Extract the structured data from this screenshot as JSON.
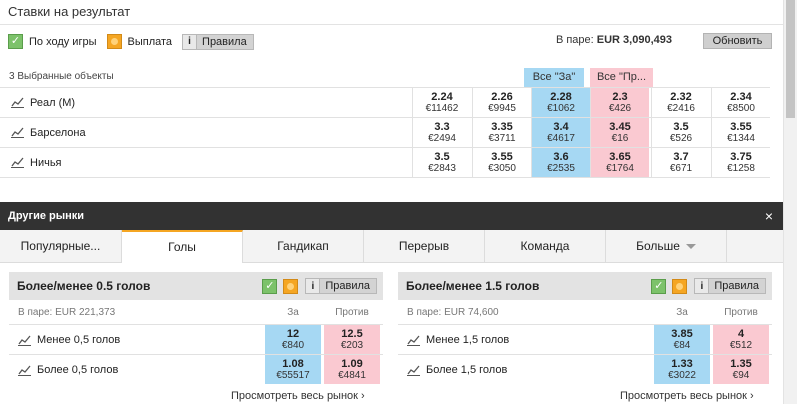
{
  "title": "Ставки на результат",
  "options": {
    "in_play_label": "По ходу игры",
    "payout_label": "Выплата",
    "rules_label": "Правила"
  },
  "pool": {
    "label": "В паре:",
    "amount": "EUR 3,090,493"
  },
  "refresh_label": "Обновить",
  "selections_count": "3 Выбранные объекты",
  "all_back": "Все \"За\"",
  "all_lay": "Все \"Пр...",
  "runners": [
    {
      "name": "Реал (М)",
      "prices": [
        {
          "p": "2.24",
          "v": "€11462"
        },
        {
          "p": "2.26",
          "v": "€9945"
        },
        {
          "p": "2.28",
          "v": "€1062"
        },
        {
          "p": "2.3",
          "v": "€426"
        },
        {
          "p": "2.32",
          "v": "€2416"
        },
        {
          "p": "2.34",
          "v": "€8500"
        }
      ]
    },
    {
      "name": "Барселона",
      "prices": [
        {
          "p": "3.3",
          "v": "€2494"
        },
        {
          "p": "3.35",
          "v": "€3711"
        },
        {
          "p": "3.4",
          "v": "€4617"
        },
        {
          "p": "3.45",
          "v": "€16"
        },
        {
          "p": "3.5",
          "v": "€526"
        },
        {
          "p": "3.55",
          "v": "€1344"
        }
      ]
    },
    {
      "name": "Ничья",
      "prices": [
        {
          "p": "3.5",
          "v": "€2843"
        },
        {
          "p": "3.55",
          "v": "€3050"
        },
        {
          "p": "3.6",
          "v": "€2535"
        },
        {
          "p": "3.65",
          "v": "€1764"
        },
        {
          "p": "3.7",
          "v": "€671"
        },
        {
          "p": "3.75",
          "v": "€1258"
        }
      ]
    }
  ],
  "other_markets": {
    "title": "Другие рынки",
    "close": "×",
    "tabs": [
      "Популярные...",
      "Голы",
      "Гандикап",
      "Перерыв",
      "Команда",
      "Больше"
    ]
  },
  "markets": [
    {
      "title": "Более/менее 0.5 голов",
      "pool": "В паре: EUR 221,373",
      "col_back": "За",
      "col_lay": "Против",
      "rules": "Правила",
      "rows": [
        {
          "name": "Менее 0,5 голов",
          "back_p": "12",
          "back_v": "€840",
          "lay_p": "12.5",
          "lay_v": "€203"
        },
        {
          "name": "Более 0,5 голов",
          "back_p": "1.08",
          "back_v": "€55517",
          "lay_p": "1.09",
          "lay_v": "€4841"
        }
      ],
      "view_all": "Просмотреть весь рынок ›"
    },
    {
      "title": "Более/менее 1.5 голов",
      "pool": "В паре: EUR 74,600",
      "col_back": "За",
      "col_lay": "Против",
      "rules": "Правила",
      "rows": [
        {
          "name": "Менее 1,5 голов",
          "back_p": "3.85",
          "back_v": "€84",
          "lay_p": "4",
          "lay_v": "€512"
        },
        {
          "name": "Более 1,5 голов",
          "back_p": "1.33",
          "back_v": "€3022",
          "lay_p": "1.35",
          "lay_v": "€94"
        }
      ],
      "view_all": "Просмотреть весь рынок ›"
    }
  ]
}
